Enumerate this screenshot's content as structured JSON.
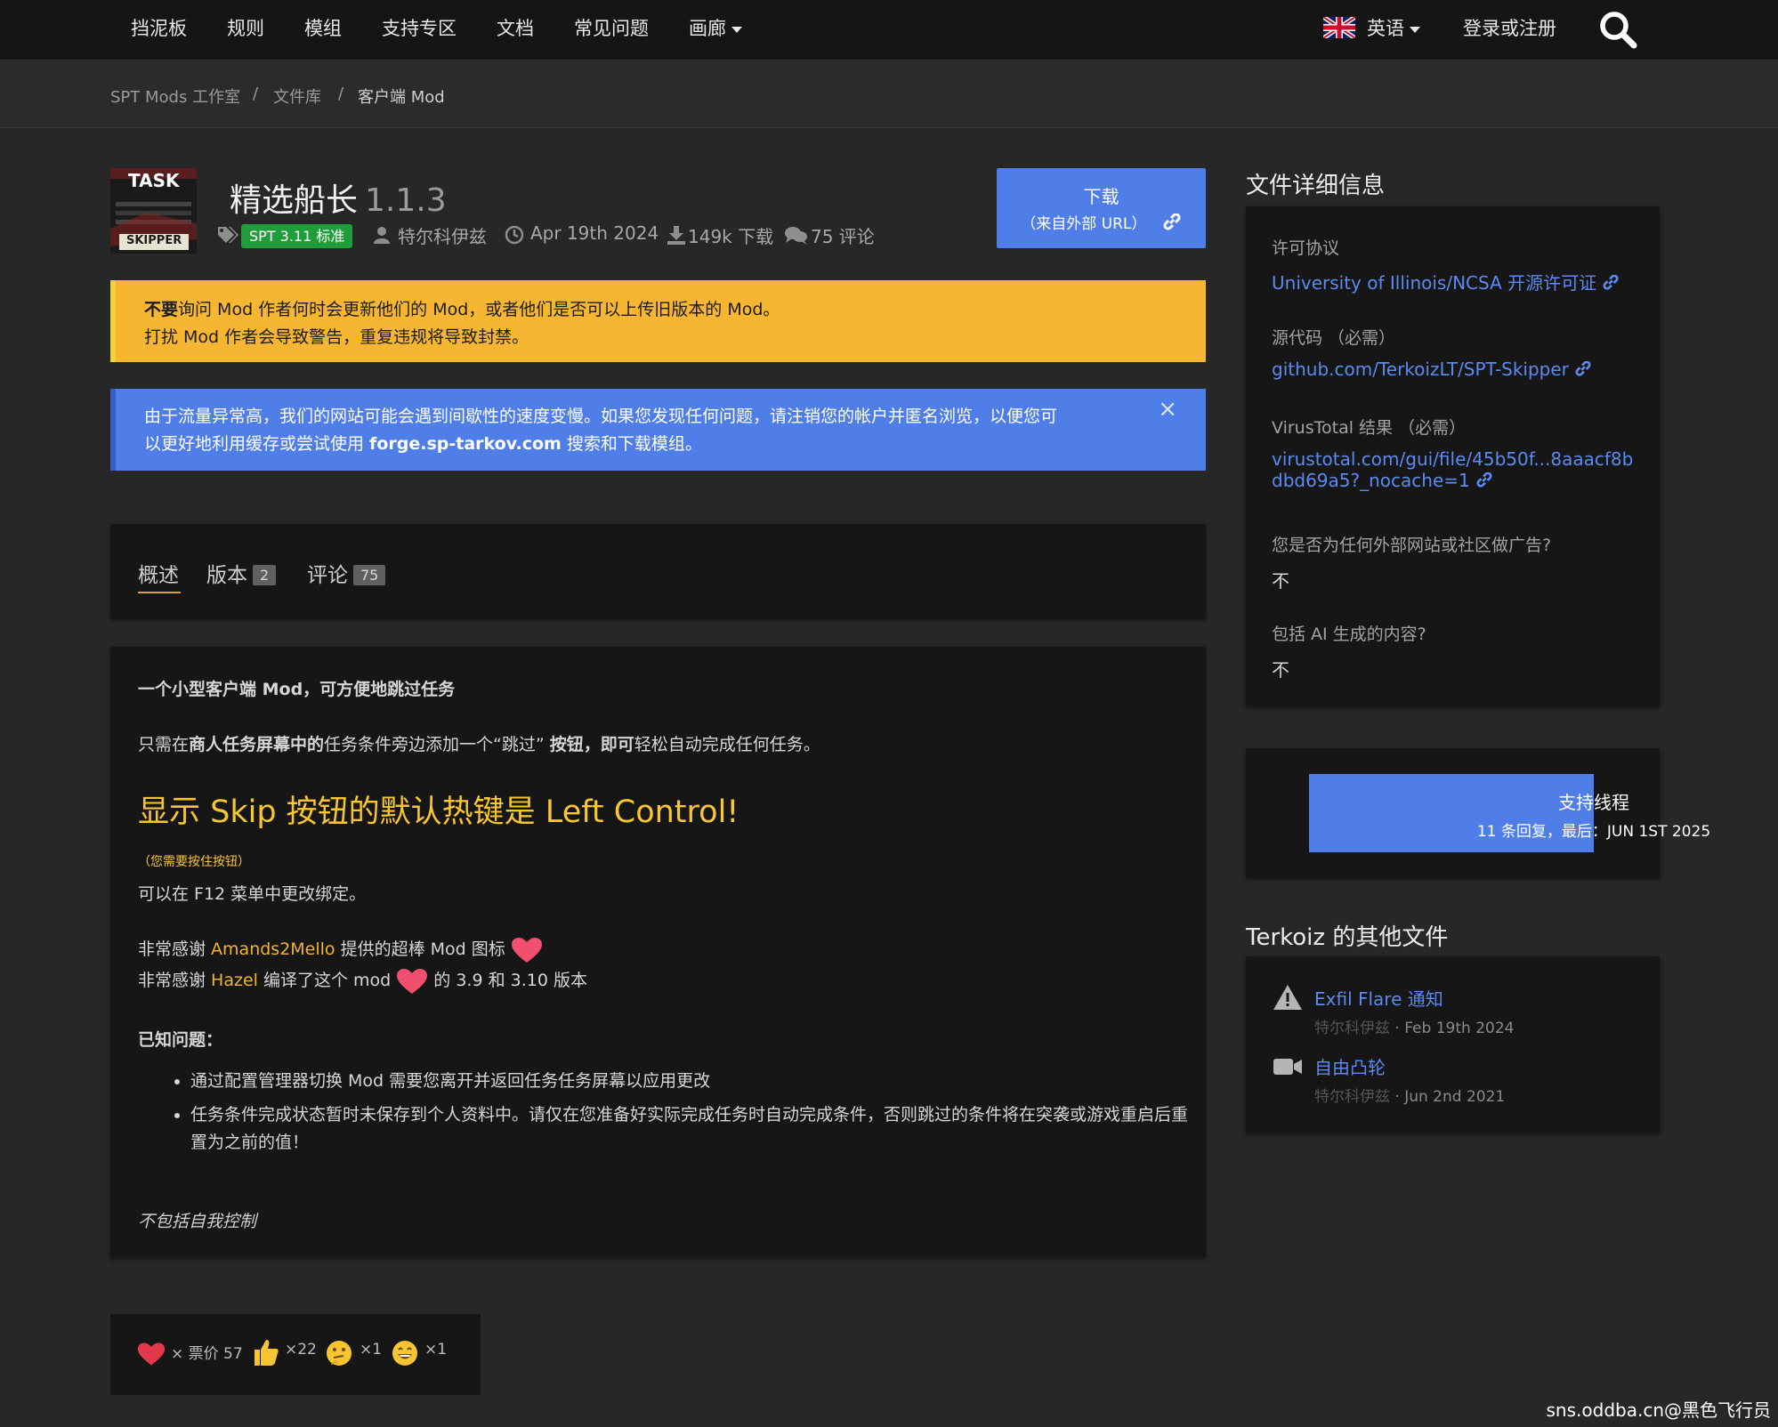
{
  "nav": {
    "items": [
      "挡泥板",
      "规则",
      "模组",
      "支持专区",
      "文档",
      "常见问题",
      "画廊"
    ],
    "language": "英语",
    "login": "登录或注册"
  },
  "breadcrumb": [
    "SPT Mods 工作室",
    "/",
    "文件库",
    "/",
    "客户端 Mod"
  ],
  "mod": {
    "thumb_text_top": "TASK",
    "thumb_text_bottom": "SKIPPER",
    "title": "精选船长",
    "version": "1.1.3",
    "spt_badge": "SPT 3.11 标准",
    "author": "特尔科伊兹",
    "date": "Apr 19th 2024",
    "downloads": "149k 下载",
    "comments": "75 评论"
  },
  "download_button": {
    "line1": "下载",
    "line2": "（来自外部 URL）"
  },
  "warning": {
    "bold": "不要",
    "line1_rest": "询问 Mod 作者何时会更新他们的 Mod，或者他们是否可以上传旧版本的 Mod。",
    "line2": "打扰 Mod 作者会导致警告，重复违规将导致封禁。"
  },
  "notice": {
    "line1": "由于流量异常高，我们的网站可能会遇到间歇性的速度变慢。如果您发现任何问题，请注销您的帐户并匿名浏览，以便您可",
    "line2_a": "以更好地利用缓存或尝试使用 ",
    "line2_bold": "forge.sp-tarkov.com",
    "line2_b": " 搜索和下载模组。",
    "close": "×"
  },
  "tabs": [
    {
      "label": "概述",
      "count": ""
    },
    {
      "label": "版本",
      "count": "2"
    },
    {
      "label": "评论",
      "count": "75"
    }
  ],
  "description": {
    "intro": "一个小型客户端 Mod，可方便地跳过任务",
    "p1_a": "只需在",
    "p1_b": "商人任务屏幕中的",
    "p1_c": "任务条件旁边添加一个“跳过” ",
    "p1_d": "按钮，即可",
    "p1_e": "轻松自动完成任何任务。",
    "hotkey_heading": "显示 Skip 按钮的默认热键是 Left Control!",
    "hotkey_note": "（您需要按住按钮）",
    "rebind": "可以在 F12 菜单中更改绑定。",
    "thanks1_a": "非常感谢 ",
    "thanks1_name": "Amands2Mello",
    "thanks1_b": " 提供的超棒 Mod 图标",
    "thanks2_a": "非常感谢 ",
    "thanks2_name": "Hazel",
    "thanks2_b": " 编译了这个 mod",
    "thanks2_c": " 的 3.9 和 3.10 版本",
    "issues_title": "已知问题：",
    "issues": [
      "通过配置管理器切换 Mod 需要您离开并返回任务任务屏幕以应用更改",
      "任务条件完成状态暂时未保存到个人资料中。请仅在您准备好实际完成任务时自动完成条件，否则跳过的条件将在突袭或游戏重启后重置为之前的值！"
    ],
    "footer_italic": "不包括自我控制"
  },
  "reactions": [
    {
      "icon": "heart-icon",
      "text": "× 票价 57"
    },
    {
      "icon": "thumbs-up-icon",
      "text": "×22"
    },
    {
      "icon": "thinking-face-icon",
      "text": "×1"
    },
    {
      "icon": "grin-face-icon",
      "text": "×1"
    }
  ],
  "file_details": {
    "title": "文件详细信息",
    "license_label": "许可协议",
    "license": "University of Illinois/NCSA 开源许可证",
    "source_label": "源代码 （必需）",
    "source": "github.com/TerkoizLT/SPT-Skipper",
    "virustotal_label": "VirusTotal 结果 （必需）",
    "virustotal_line1": "virustotal.com/gui/file/45b50f...8aaacf8b",
    "virustotal_line2": "dbd69a5?_nocache=1",
    "ads_label": "您是否为任何外部网站或社区做广告?",
    "ads_value": "不",
    "ai_label": "包括 AI 生成的内容?",
    "ai_value": "不"
  },
  "support": {
    "line1": "支持线程",
    "line2": "11 条回复，最后：JUN 1ST 2025"
  },
  "other_files": {
    "title": "Terkoiz 的其他文件",
    "items": [
      {
        "icon": "warning-icon",
        "name": "Exfil Flare 通知",
        "author": "特尔科伊兹",
        "date": " · Feb 19th 2024"
      },
      {
        "icon": "video-camera-icon",
        "name": "自由凸轮",
        "author": "特尔科伊兹",
        "date": " · Jun 2nd 2021"
      }
    ]
  },
  "watermark": "sns.oddba.cn@黑色飞行员",
  "colors": {
    "accent": "#4f7ee8",
    "warning": "#f6b631",
    "highlight": "#f2b32e",
    "badge": "#1f9d3a"
  }
}
